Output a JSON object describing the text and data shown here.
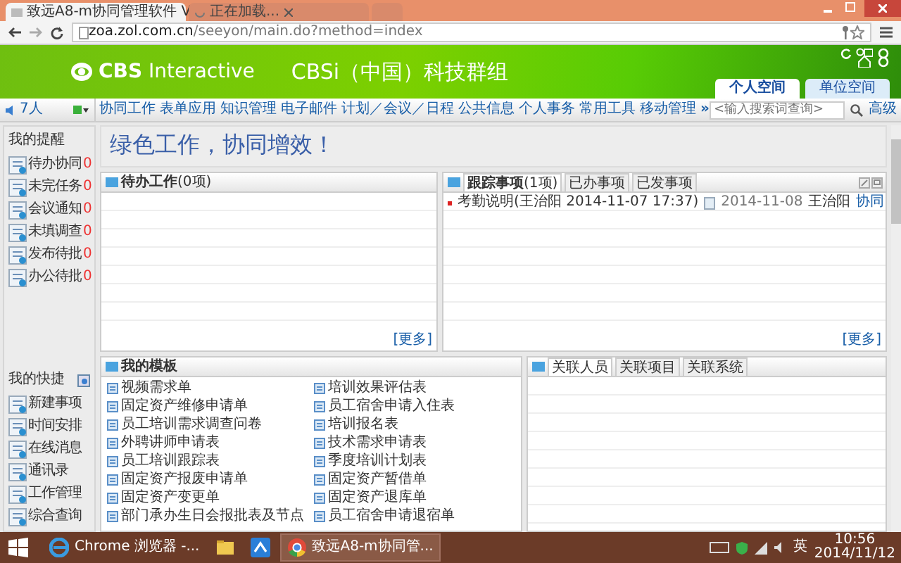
{
  "browser": {
    "tabs": [
      {
        "title": "致远A8-m协同管理软件 V",
        "selected": true
      },
      {
        "title": "正在加载...",
        "selected": false
      }
    ],
    "url_host": "zoa.zol.com.cn",
    "url_path": "/seeyon/main.do?method=index"
  },
  "banner": {
    "logo": "**CBS** Interactive",
    "group_name": "CBSi（中国）科技群组",
    "space_tabs": [
      {
        "label": "个人空间",
        "selected": true
      },
      {
        "label": "单位空间",
        "selected": false
      }
    ]
  },
  "navbar": {
    "online_count": "7人",
    "menu": [
      "协同工作",
      "表单应用",
      "知识管理",
      "电子邮件",
      "计划／会议／日程",
      "公共信息",
      "个人事务",
      "常用工具",
      "移动管理"
    ],
    "more": "»",
    "search": {
      "placeholder": "<输入搜索词查询>"
    },
    "advanced": "高级"
  },
  "sidebar": {
    "reminders": {
      "title": "我的提醒",
      "items": [
        {
          "label": "待办协同",
          "count": "0"
        },
        {
          "label": "未完任务",
          "count": "0"
        },
        {
          "label": "会议通知",
          "count": "0"
        },
        {
          "label": "未填调查",
          "count": "0"
        },
        {
          "label": "发布待批",
          "count": "0"
        },
        {
          "label": "办公待批",
          "count": "0"
        }
      ]
    },
    "shortcuts": {
      "title": "我的快捷",
      "items": [
        "新建事项",
        "时间安排",
        "在线消息",
        "通讯录",
        "工作管理",
        "综合查询"
      ]
    }
  },
  "slogan": "绿色工作，协同增效！",
  "todo_panel": {
    "title": "**待办工作**(0项)",
    "more": "[更多]"
  },
  "tracking_panel": {
    "tabs": [
      {
        "label": "**跟踪事项**(1项)",
        "selected": true
      },
      {
        "label": "已办事项",
        "selected": false
      },
      {
        "label": "已发事项",
        "selected": false
      }
    ],
    "rows": [
      {
        "subject": "考勤说明(王治阳 2014-11-07 17:37)",
        "date": "2014-11-08",
        "sender": "王治阳",
        "category": "协同"
      }
    ],
    "more": "[更多]"
  },
  "templates_panel": {
    "title": "我的模板",
    "items": [
      "视频需求单",
      "培训效果评估表",
      "固定资产维修申请单",
      "员工宿舍申请入住表",
      "员工培训需求调查问卷",
      "培训报名表",
      "外聘讲师申请表",
      "技术需求申请表",
      "员工培训跟踪表",
      "季度培训计划表",
      "固定资产报废申请单",
      "固定资产暂借单",
      "固定资产变更单",
      "固定资产退库单",
      "部门承办生日会报批表及节点",
      "员工宿舍申请退宿单"
    ]
  },
  "related_panel": {
    "tabs": [
      {
        "label": "关联人员",
        "selected": true
      },
      {
        "label": "关联项目",
        "selected": false
      },
      {
        "label": "关联系统",
        "selected": false
      }
    ]
  },
  "taskbar": {
    "items": [
      {
        "kind": "ie",
        "label": "Chrome 浏览器 -...",
        "selected": false
      },
      {
        "kind": "folder",
        "selected": false
      },
      {
        "kind": "cloud",
        "selected": false
      },
      {
        "kind": "chrome",
        "label": "致远A8-m协同管...",
        "selected": true
      }
    ],
    "tray": {
      "language": "英",
      "time": "10:56",
      "date": "2014/11/12"
    }
  }
}
